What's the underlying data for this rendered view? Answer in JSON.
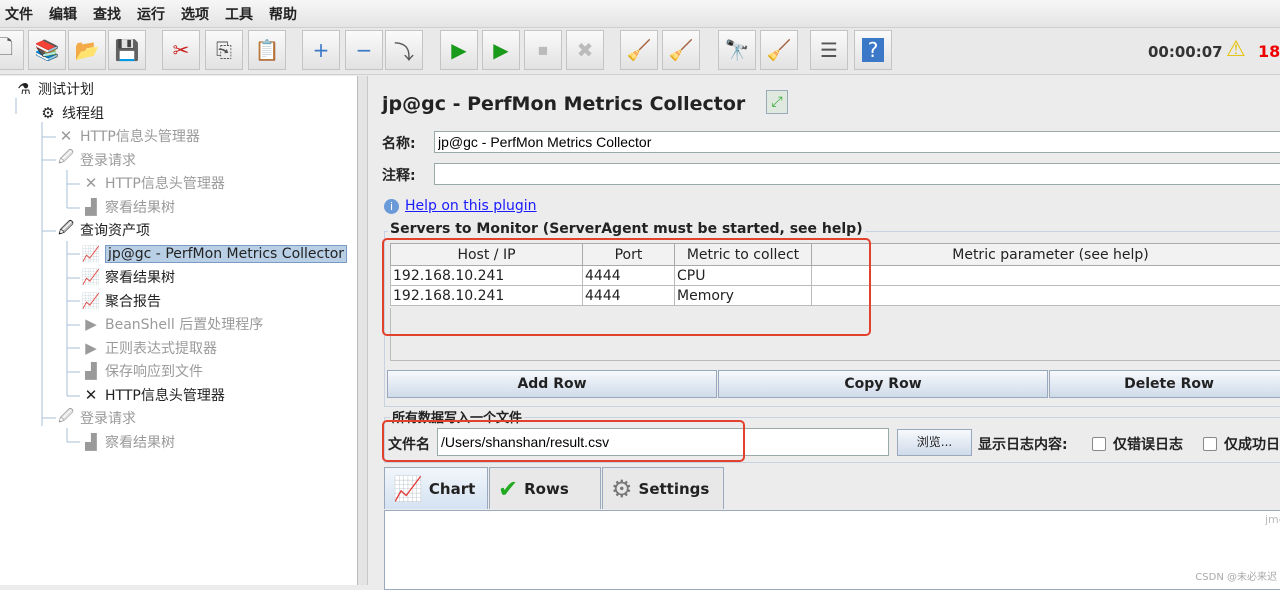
{
  "menu": [
    "文件",
    "编辑",
    "查找",
    "运行",
    "选项",
    "工具",
    "帮助"
  ],
  "toolbar": {
    "buttons": [
      {
        "name": "new-icon",
        "glyph": "🗋"
      },
      {
        "name": "templates-icon",
        "glyph": "📚"
      },
      {
        "name": "open-icon",
        "glyph": "📂"
      },
      {
        "name": "save-icon",
        "glyph": "💾"
      },
      {
        "name": "cut-icon",
        "glyph": "✂"
      },
      {
        "name": "copy-icon",
        "glyph": "⎘"
      },
      {
        "name": "paste-icon",
        "glyph": "📋"
      },
      {
        "name": "expand-all-icon",
        "glyph": "+"
      },
      {
        "name": "collapse-all-icon",
        "glyph": "−"
      },
      {
        "name": "toggle-icon",
        "glyph": "⤵"
      },
      {
        "name": "start-icon",
        "glyph": "▶"
      },
      {
        "name": "start-no-pause-icon",
        "glyph": "▶"
      },
      {
        "name": "stop-icon",
        "glyph": "⏹"
      },
      {
        "name": "shutdown-icon",
        "glyph": "✖"
      },
      {
        "name": "clear-icon",
        "glyph": "🧹"
      },
      {
        "name": "clear-all-icon",
        "glyph": "🧹"
      },
      {
        "name": "search-icon",
        "glyph": "🔭"
      },
      {
        "name": "reset-search-icon",
        "glyph": "🧹"
      },
      {
        "name": "function-helper-icon",
        "glyph": "☰"
      },
      {
        "name": "help-icon",
        "glyph": "?"
      }
    ],
    "timer": "00:00:07",
    "error_count": "18"
  },
  "tree": [
    {
      "label": "测试计划",
      "level": 0,
      "dim": false,
      "icon": "flask-icon",
      "glyph": "⚗"
    },
    {
      "label": "线程组",
      "level": 1,
      "dim": false,
      "icon": "gear-icon",
      "glyph": "⚙"
    },
    {
      "label": "HTTP信息头管理器",
      "level": 2,
      "dim": true,
      "icon": "wrench-icon",
      "glyph": "✕"
    },
    {
      "label": "登录请求",
      "level": 2,
      "dim": true,
      "icon": "pipette-icon",
      "glyph": "🖉"
    },
    {
      "label": "HTTP信息头管理器",
      "level": 3,
      "dim": true,
      "icon": "wrench-icon",
      "glyph": "✕"
    },
    {
      "label": "察看结果树",
      "level": 3,
      "dim": true,
      "icon": "listener-icon",
      "glyph": "▟"
    },
    {
      "label": "查询资产项",
      "level": 2,
      "dim": false,
      "icon": "pipette-icon",
      "glyph": "🖉"
    },
    {
      "label": "jp@gc - PerfMon Metrics Collector",
      "level": 3,
      "dim": false,
      "selected": true,
      "icon": "graph-icon",
      "glyph": "📈"
    },
    {
      "label": "察看结果树",
      "level": 3,
      "dim": false,
      "icon": "graph-icon",
      "glyph": "📈"
    },
    {
      "label": "聚合报告",
      "level": 3,
      "dim": false,
      "icon": "graph-icon",
      "glyph": "📈"
    },
    {
      "label": "BeanShell 后置处理程序",
      "level": 3,
      "dim": true,
      "icon": "postprocessor-icon",
      "glyph": "▶"
    },
    {
      "label": "正则表达式提取器",
      "level": 3,
      "dim": true,
      "icon": "postprocessor-icon",
      "glyph": "▶"
    },
    {
      "label": "保存响应到文件",
      "level": 3,
      "dim": true,
      "icon": "listener-icon",
      "glyph": "▟"
    },
    {
      "label": "HTTP信息头管理器",
      "level": 3,
      "dim": false,
      "icon": "wrench-icon",
      "glyph": "✕"
    },
    {
      "label": "登录请求",
      "level": 2,
      "dim": true,
      "icon": "pipette-icon",
      "glyph": "🖉"
    },
    {
      "label": "察看结果树",
      "level": 3,
      "dim": true,
      "icon": "listener-icon",
      "glyph": "▟"
    }
  ],
  "panel": {
    "title": "jp@gc - PerfMon Metrics Collector",
    "name_label": "名称:",
    "name_value": "jp@gc - PerfMon Metrics Collector",
    "comment_label": "注释:",
    "comment_value": "",
    "help_link": "Help on this plugin",
    "servers_legend": "Servers to Monitor (ServerAgent must be started, see help)",
    "columns": [
      "Host / IP",
      "Port",
      "Metric to collect",
      "Metric parameter (see help)"
    ],
    "rows": [
      [
        "192.168.10.241",
        "4444",
        "CPU",
        ""
      ],
      [
        "192.168.10.241",
        "4444",
        "Memory",
        ""
      ]
    ],
    "add_row": "Add Row",
    "copy_row": "Copy Row",
    "delete_row": "Delete Row",
    "file_legend": "所有数据写入一个文件",
    "file_label": "文件名",
    "file_value": "/Users/shanshan/result.csv",
    "browse": "浏览...",
    "log_label": "显示日志内容:",
    "errors_only": "仅错误日志",
    "success_only": "仅成功日志",
    "tabs": [
      "Chart",
      "Rows",
      "Settings"
    ],
    "chart_watermark": "jmeter-plugins.org",
    "csdn_watermark": "CSDN @未必来迟"
  }
}
